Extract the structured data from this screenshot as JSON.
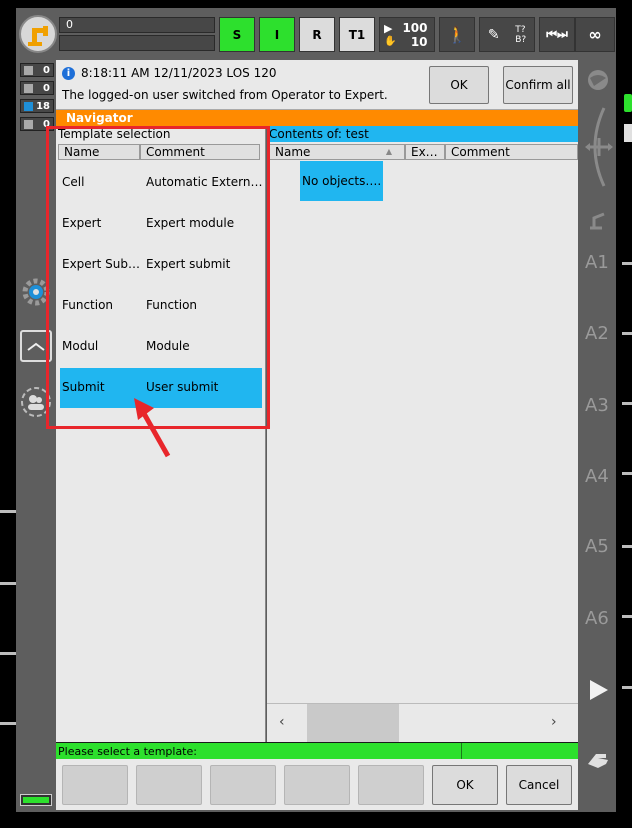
{
  "topbar": {
    "status_top": "0",
    "status_bottom": "",
    "btn_s": "S",
    "btn_i": "I",
    "btn_r": "R",
    "btn_t1": "T1",
    "override_top": "100",
    "override_bottom": "10",
    "tool_t": "T?",
    "tool_b": "B?",
    "infinity": "∞"
  },
  "counters": [
    {
      "value": "0"
    },
    {
      "value": "0"
    },
    {
      "value": "18"
    },
    {
      "value": "0"
    }
  ],
  "message": {
    "header": "8:18:11 AM 12/11/2023 LOS 120",
    "text": "The logged-on user switched from Operator to Expert.",
    "ok_label": "OK",
    "confirm_all_label": "Confirm all"
  },
  "navigator": {
    "title": "Navigator"
  },
  "template_pane": {
    "title": "Template selection",
    "col_name": "Name",
    "col_comment": "Comment",
    "rows": [
      {
        "name": "Cell",
        "comment": "Automatic Extern…"
      },
      {
        "name": "Expert",
        "comment": "Expert module"
      },
      {
        "name": "Expert Sub…",
        "comment": "Expert submit"
      },
      {
        "name": "Function",
        "comment": "Function"
      },
      {
        "name": "Modul",
        "comment": "Module"
      },
      {
        "name": "Submit",
        "comment": "User submit"
      }
    ],
    "selected_index": 5
  },
  "contents_pane": {
    "title": "Contents of: test",
    "col_name": "Name",
    "col_ex": "Ex…",
    "col_comment": "Comment",
    "empty_text": "No objects…."
  },
  "status": {
    "text": "Please select a template:"
  },
  "bottom": {
    "ok_label": "OK",
    "cancel_label": "Cancel"
  },
  "axes": [
    "A1",
    "A2",
    "A3",
    "A4",
    "A5",
    "A6"
  ],
  "colors": {
    "accent_blue": "#20b6f0",
    "status_green": "#2de02d",
    "navigator_orange": "#ff8a00",
    "annotation_red": "#e8262b"
  }
}
